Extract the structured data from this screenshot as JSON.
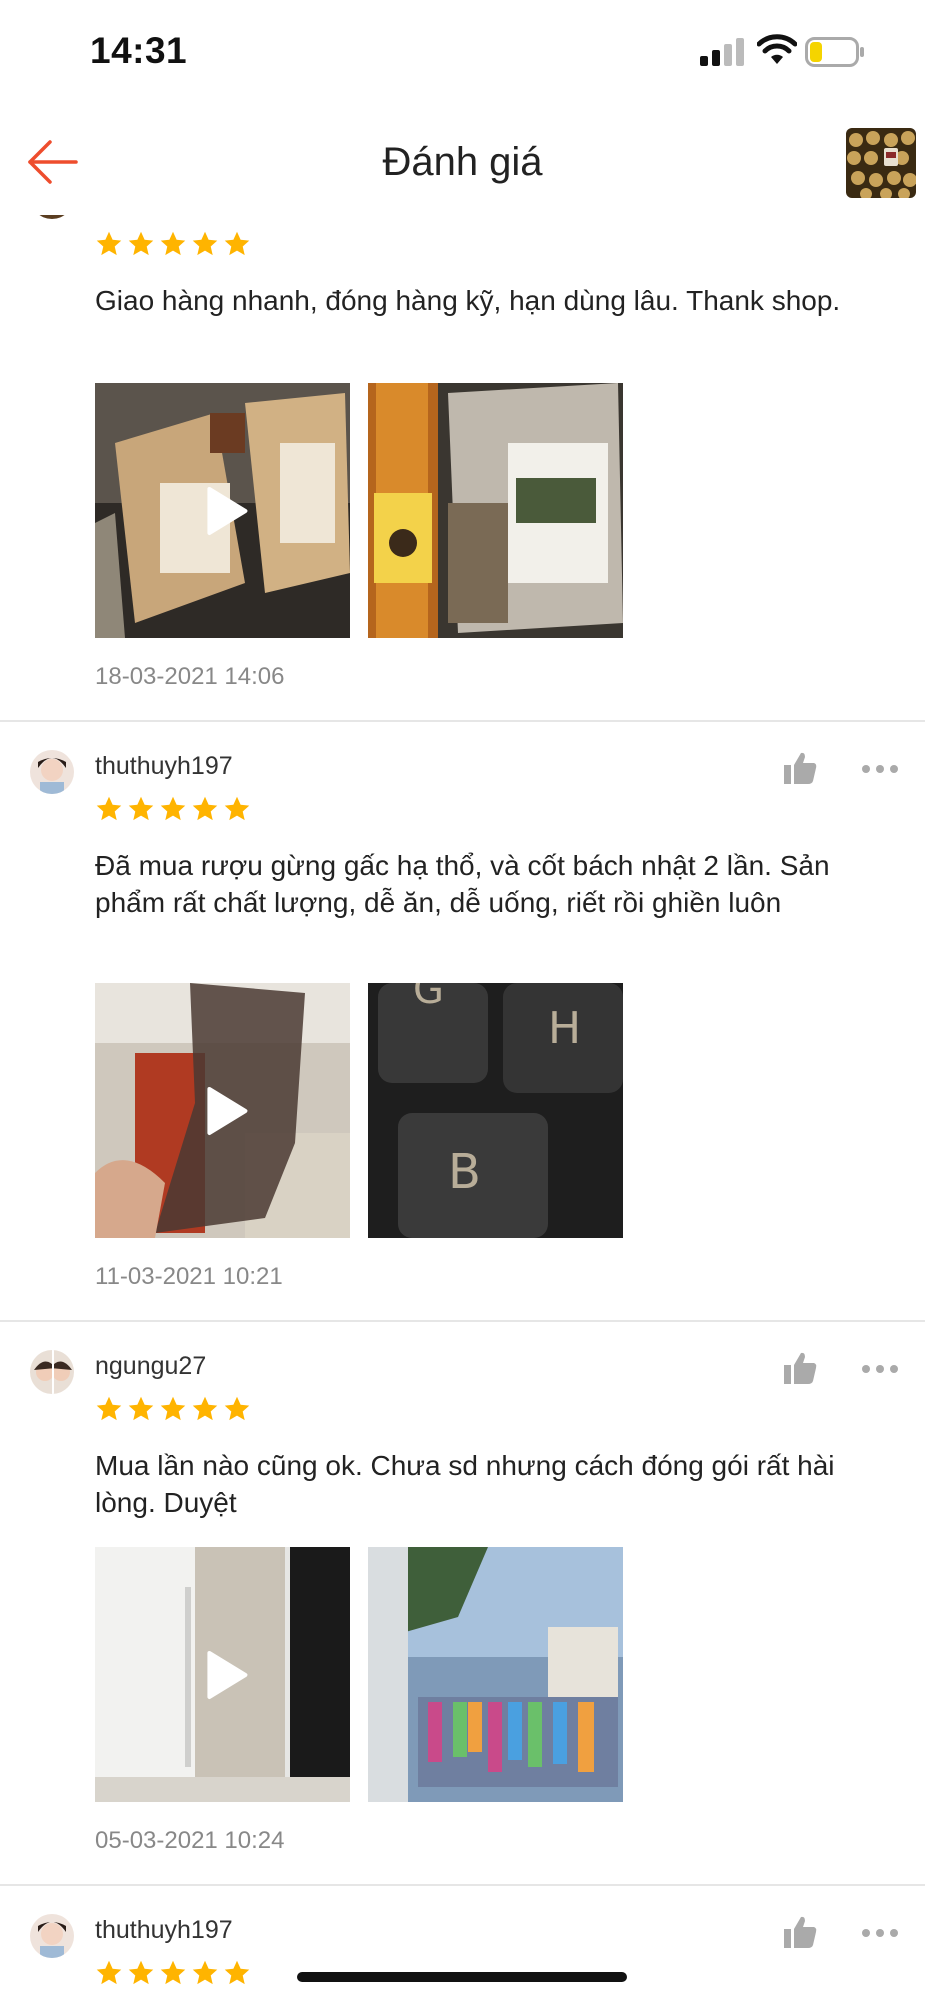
{
  "status_bar": {
    "time": "14:31"
  },
  "header": {
    "title": "Đánh giá"
  },
  "reviews": [
    {
      "username": "",
      "rating": 5,
      "comment": "Giao hàng nhanh, đóng hàng kỹ, hạn dùng lâu. Thank shop.",
      "date": "18-03-2021 14:06",
      "media": [
        {
          "type": "video"
        },
        {
          "type": "image"
        }
      ]
    },
    {
      "username": "thuthuyh197",
      "rating": 5,
      "comment": "Đã mua rượu gừng gấc hạ thổ, và cốt bách nhật 2 lần. Sản phẩm rất chất lượng, dễ ăn, dễ uống, riết rồi ghiền luôn",
      "date": "11-03-2021 10:21",
      "media": [
        {
          "type": "video"
        },
        {
          "type": "image"
        }
      ]
    },
    {
      "username": "ngungu27",
      "rating": 5,
      "comment": "Mua lần nào cũng ok. Chưa sd nhưng cách đóng gói rất hài lòng. Duyệt",
      "date": "05-03-2021 10:24",
      "media": [
        {
          "type": "video"
        },
        {
          "type": "image"
        }
      ]
    },
    {
      "username": "thuthuyh197",
      "rating": 5
    }
  ],
  "colors": {
    "accent": "#ee4d2d",
    "star": "#ffb400",
    "battery": "#f5d400"
  }
}
